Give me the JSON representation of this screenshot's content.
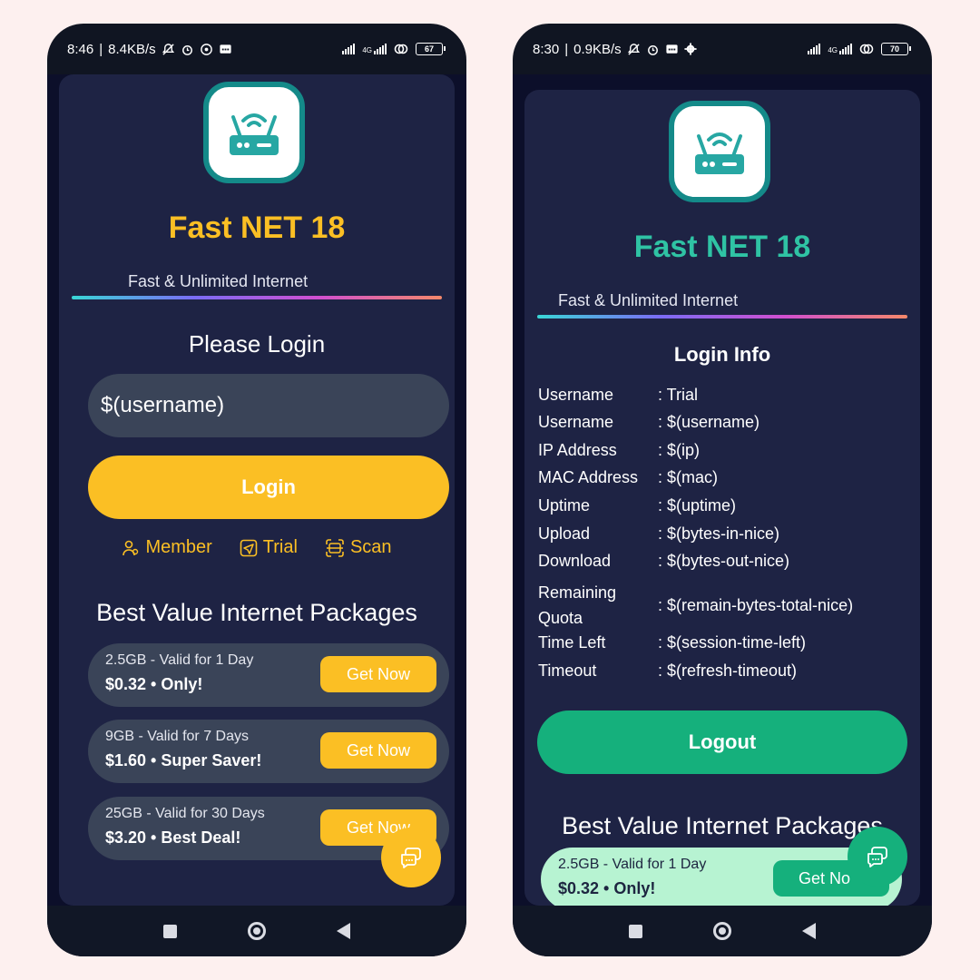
{
  "left": {
    "status": {
      "time": "8:46",
      "speed": "8.4KB/s",
      "network": "4G",
      "battery": "67"
    },
    "app_title": "Fast NET 18",
    "tagline": "Fast & Unlimited Internet",
    "heading": "Please Login",
    "username_value": "$(username)",
    "login_label": "Login",
    "links": {
      "member": "Member",
      "trial": "Trial",
      "scan": "Scan"
    },
    "packages_heading": "Best Value Internet Packages",
    "packages": [
      {
        "title": "2.5GB - Valid for 1 Day",
        "price": "$0.32 • Only!",
        "button": "Get Now"
      },
      {
        "title": "9GB - Valid for 7 Days",
        "price": "$1.60 • Super Saver!",
        "button": "Get Now"
      },
      {
        "title": "25GB - Valid for 30 Days",
        "price": "$3.20 • Best Deal!",
        "button": "Get Now"
      }
    ],
    "accent_color": "#fbbf24"
  },
  "right": {
    "status": {
      "time": "8:30",
      "speed": "0.9KB/s",
      "network": "4G",
      "battery": "70"
    },
    "app_title": "Fast NET 18",
    "tagline": "Fast & Unlimited Internet",
    "heading": "Login Info",
    "info": [
      {
        "label": "Username",
        "value": ": Trial"
      },
      {
        "label": "Username",
        "value": ": $(username)"
      },
      {
        "label": "IP Address",
        "value": ": $(ip)"
      },
      {
        "label": "MAC Address",
        "value": ": $(mac)"
      },
      {
        "label": "Uptime",
        "value": ": $(uptime)"
      },
      {
        "label": "Upload",
        "value": ": $(bytes-in-nice)"
      },
      {
        "label": "Download",
        "value": ": $(bytes-out-nice)"
      },
      {
        "label": "Remaining Quota",
        "value": ": $(remain-bytes-total-nice)"
      },
      {
        "label": "Time Left",
        "value": ": $(session-time-left)"
      },
      {
        "label": "Timeout",
        "value": ": $(refresh-timeout)"
      }
    ],
    "logout_label": "Logout",
    "packages_heading": "Best Value Internet Packages",
    "packages": [
      {
        "title": "2.5GB - Valid for 1 Day",
        "price": "$0.32 • Only!",
        "button": "Get No"
      }
    ],
    "accent_color": "#15b07c"
  }
}
